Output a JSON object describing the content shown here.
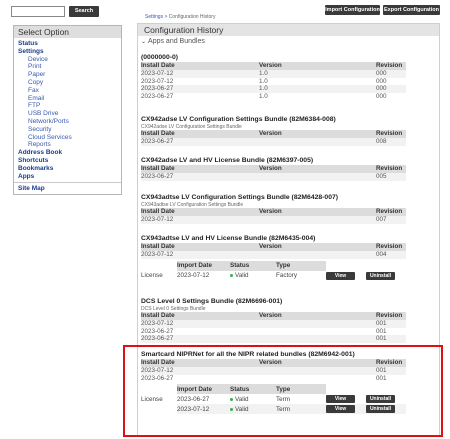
{
  "search": {
    "placeholder": "",
    "button_label": "Search"
  },
  "toolbar": {
    "import_label": "Import Configuration",
    "export_label": "Export Configuration"
  },
  "breadcrumb": {
    "parent": "Settings",
    "separator": " > ",
    "current": "Configuration History"
  },
  "sidebar": {
    "title": "Select Option",
    "items": [
      {
        "label": "Status",
        "level": "top"
      },
      {
        "label": "Settings",
        "level": "top"
      },
      {
        "label": "Device",
        "level": "sub"
      },
      {
        "label": "Print",
        "level": "sub"
      },
      {
        "label": "Paper",
        "level": "sub"
      },
      {
        "label": "Copy",
        "level": "sub"
      },
      {
        "label": "Fax",
        "level": "sub"
      },
      {
        "label": "Email",
        "level": "sub"
      },
      {
        "label": "FTP",
        "level": "sub"
      },
      {
        "label": "USB Drive",
        "level": "sub"
      },
      {
        "label": "Network/Ports",
        "level": "sub"
      },
      {
        "label": "Security",
        "level": "sub"
      },
      {
        "label": "Cloud Services",
        "level": "sub"
      },
      {
        "label": "Reports",
        "level": "sub"
      },
      {
        "label": "Address Book",
        "level": "top"
      },
      {
        "label": "Shortcuts",
        "level": "top"
      },
      {
        "label": "Bookmarks",
        "level": "top"
      },
      {
        "label": "Apps",
        "level": "top"
      }
    ],
    "site_map": "Site Map"
  },
  "panel": {
    "title": "Configuration History",
    "apps_header": "Apps and Bundles",
    "headers": {
      "date": "Install Date",
      "version": "Version",
      "revision": "Revision"
    },
    "license_headers": {
      "import_date": "Import Date",
      "status": "Status",
      "type": "Type"
    },
    "view_label": "View",
    "uninstall_label": "Uninstall",
    "license_label": "License",
    "bundles": [
      {
        "title": "(0000000-0)",
        "subtitle": "",
        "rows": [
          {
            "date": "2023-07-12",
            "version": "1.0",
            "revision": "000"
          },
          {
            "date": "2023-07-12",
            "version": "1.0",
            "revision": "000"
          },
          {
            "date": "2023-06-27",
            "version": "1.0",
            "revision": "000"
          },
          {
            "date": "2023-06-27",
            "version": "1.0",
            "revision": "000"
          }
        ]
      },
      {
        "title": "CX942adse LV Configuration Settings Bundle (82M6384-008)",
        "subtitle": "CX942adse LV Configuration Settings Bundle",
        "rows": [
          {
            "date": "2023-06-27",
            "version": "",
            "revision": "008"
          }
        ]
      },
      {
        "title": "CX942adse LV and HV License Bundle (82M6397-005)",
        "subtitle": "",
        "rows": [
          {
            "date": "2023-06-27",
            "version": "",
            "revision": "005"
          }
        ]
      },
      {
        "title": "CX943adtse LV Configuration Settings Bundle (82M6428-007)",
        "subtitle": "CX943adtse LV Configuration Settings Bundle",
        "rows": [
          {
            "date": "2023-07-12",
            "version": "",
            "revision": "007"
          }
        ]
      },
      {
        "title": "CX943adtse LV and HV License Bundle (82M6435-004)",
        "subtitle": "",
        "rows": [
          {
            "date": "2023-07-12",
            "version": "",
            "revision": "004"
          }
        ],
        "licenses": [
          {
            "import_date": "2023-07-12",
            "status": "Valid",
            "type": "Factory"
          }
        ]
      },
      {
        "title": "DCS Level 0 Settings Bundle (82M6696-001)",
        "subtitle": "DCS Level 0 Settings Bundle",
        "rows": [
          {
            "date": "2023-07-12",
            "version": "",
            "revision": "001"
          },
          {
            "date": "2023-06-27",
            "version": "",
            "revision": "001"
          },
          {
            "date": "2023-06-27",
            "version": "",
            "revision": "001"
          }
        ]
      },
      {
        "title": "Smartcard NIPRNet for all the NIPR related bundles (82M6942-001)",
        "subtitle": "",
        "rows": [
          {
            "date": "2023-07-12",
            "version": "",
            "revision": "001"
          },
          {
            "date": "2023-06-27",
            "version": "",
            "revision": "001"
          }
        ],
        "licenses": [
          {
            "import_date": "2023-06-27",
            "status": "Valid",
            "type": "Term"
          },
          {
            "import_date": "2023-07-12",
            "status": "Valid",
            "type": "Term"
          }
        ]
      }
    ]
  },
  "colors": {
    "button": "#3a3a3a",
    "link": "#1a3c8c",
    "valid": "#2fb34a",
    "highlight": "#e01010"
  }
}
